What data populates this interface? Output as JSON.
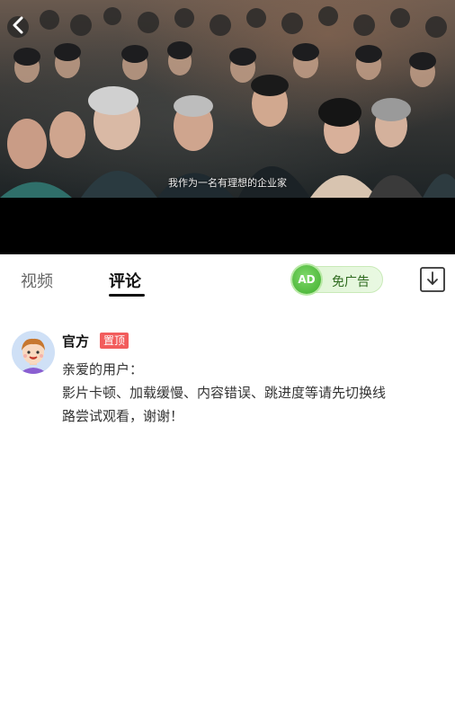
{
  "video": {
    "subtitle": "我作为一名有理想的企业家"
  },
  "tabs": [
    {
      "label": "视频",
      "active": false
    },
    {
      "label": "评论",
      "active": true
    }
  ],
  "ad_toggle": {
    "badge": "AD",
    "label": "免广告"
  },
  "icons": {
    "back": "back-arrow-icon",
    "download": "download-icon",
    "avatar": "avatar-icon"
  },
  "comment": {
    "author": "官方",
    "badge": "置顶",
    "lines": [
      "亲爱的用户：",
      "影片卡顿、加载缓慢、内容错误、跳进度等请先切换线",
      "路尝试观看，谢谢！"
    ]
  },
  "colors": {
    "accent_green": "#3fae2c",
    "pin_red": "#f25c5c",
    "active_tab": "#111111",
    "inactive_tab": "#666666"
  }
}
